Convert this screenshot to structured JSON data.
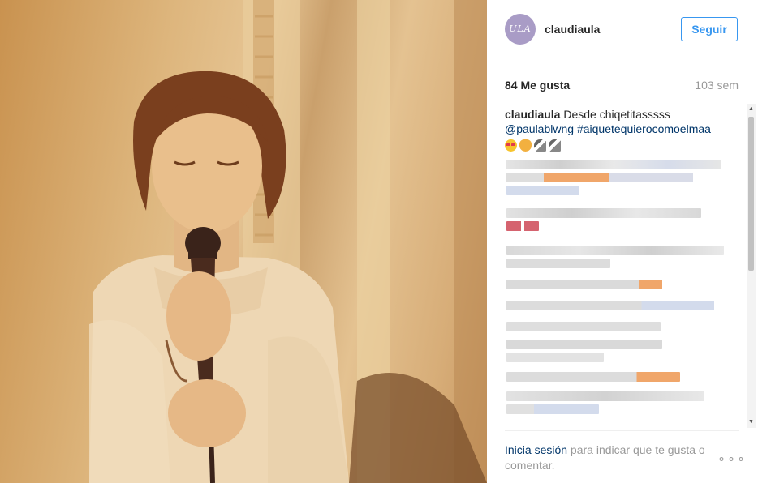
{
  "post": {
    "username": "claudiaula",
    "avatar_text": "ULA",
    "follow_label": "Seguir",
    "likes": "84 Me gusta",
    "age": "103 sem",
    "caption_user": "claudiaula",
    "caption_text": "Desde chiqetitasssss",
    "mention": "@paulablwng",
    "hashtag": "#aiquetequierocomoelmaa",
    "caption_emojis": [
      "heart-eyes-face-icon",
      "clapping-hands-icon",
      "microphone-icon",
      "microphone-icon"
    ]
  },
  "footer": {
    "login_link": "Inicia sesión",
    "login_text": " para indicar que te gusta o comentar.",
    "more_label": "∘∘∘"
  },
  "colors": {
    "accent": "#3897f0",
    "link": "#003569",
    "muted": "#999999",
    "avatar_bg": "#a99cc6",
    "photo_tint": "#d7ad78"
  }
}
